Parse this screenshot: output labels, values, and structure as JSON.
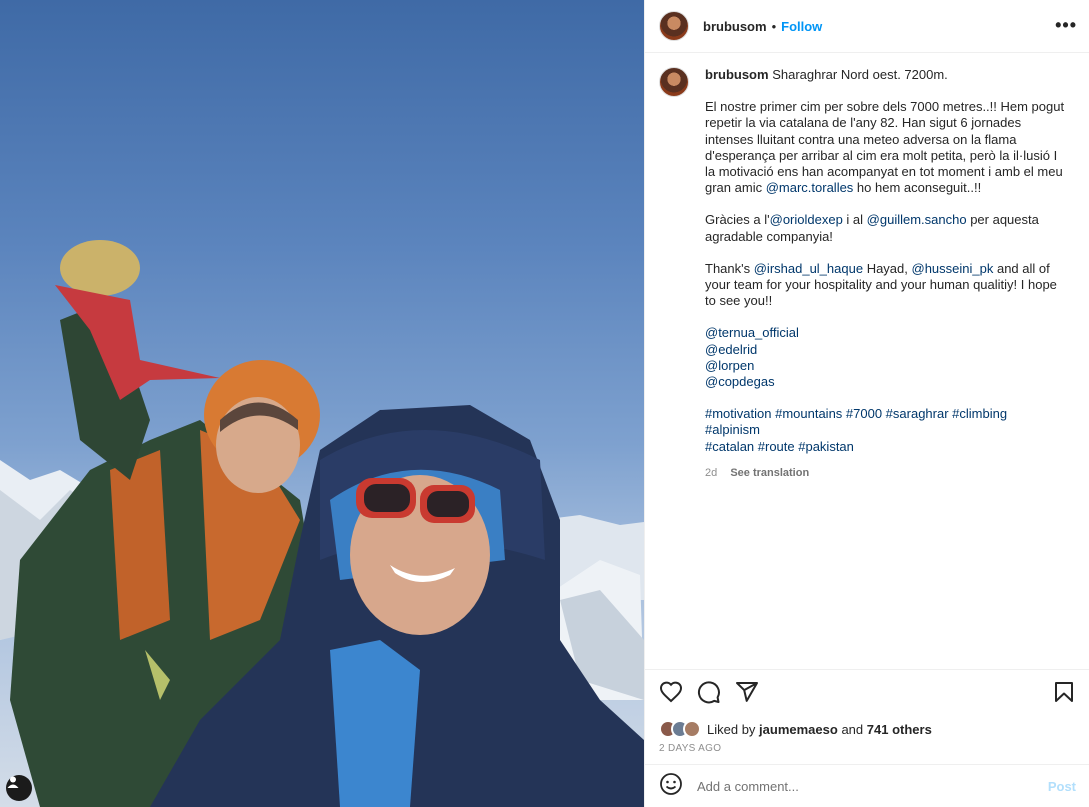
{
  "post": {
    "username": "brubusom",
    "follow_label": "Follow",
    "dot": "•",
    "more_label": "•••"
  },
  "caption": {
    "username": "brubusom",
    "title": "Sharaghrar Nord oest. 7200m.",
    "p1_text": "El nostre primer cim per sobre dels 7000 metres..!! Hem pogut repetir la via catalana de l'any 82. Han sigut 6 jornades intenses lluitant contra una meteo adversa on la flama d'esperança per arribar al cim era molt petita, però la il·lusió I la motivació ens han acompanyat en tot moment i amb el meu gran amic ",
    "p1_mention": "@marc.toralles",
    "p1_end": " ho hem aconseguit..!!",
    "p2_a": "Gràcies a l'",
    "p2_m1": "@orioldexep",
    "p2_b": " i al ",
    "p2_m2": "@guillem.sancho",
    "p2_c": " per aquesta agradable companyia!",
    "p3_a": "Thank's ",
    "p3_m1": "@irshad_ul_haque",
    "p3_b": " Hayad, ",
    "p3_m2": "@husseini_pk",
    "p3_c": " and all of your team for your hospitality and your human qualitiy! I hope to see you!!",
    "sponsors": [
      "@ternua_official",
      "@edelrid",
      "@lorpen",
      "@copdegas"
    ],
    "hashtags_line1": "#motivation #mountains #7000 #saraghrar #climbing",
    "hashtags_line2": "#alpinism",
    "hashtags_line3": "#catalan #route #pakistan",
    "age": "2d",
    "see_translation": "See translation"
  },
  "likes": {
    "prefix": "Liked by ",
    "user": "jaumemaeso",
    "middle": " and ",
    "others": "741 others",
    "date": "2 DAYS AGO"
  },
  "comment": {
    "placeholder": "Add a comment...",
    "post_label": "Post"
  },
  "colors": {
    "link": "#00376b",
    "follow": "#0095f6",
    "post_disabled": "#b2dffc"
  },
  "icons": [
    "heart-icon",
    "comment-icon",
    "share-icon",
    "bookmark-icon",
    "emoji-icon",
    "user-tag-icon"
  ]
}
